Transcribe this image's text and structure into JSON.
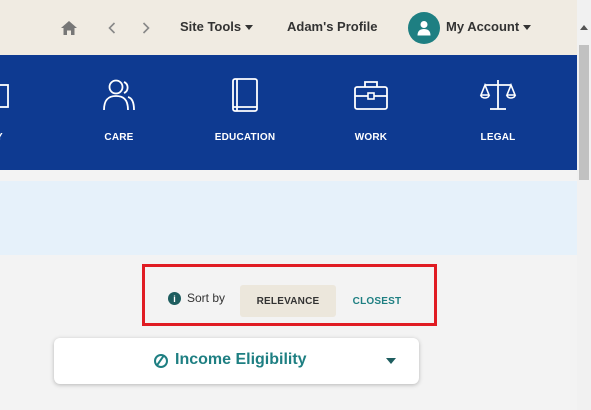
{
  "topbar": {
    "icons": {
      "home": "home-icon",
      "back": "chevron-left-icon",
      "forward": "chevron-right-icon"
    },
    "site_tools_label": "Site Tools",
    "profile_link_label": "Adam's Profile",
    "my_account_label": "My Account"
  },
  "categories": [
    {
      "label": "Y",
      "icon": "partial-icon"
    },
    {
      "label": "CARE",
      "icon": "people-icon"
    },
    {
      "label": "EDUCATION",
      "icon": "book-icon"
    },
    {
      "label": "WORK",
      "icon": "briefcase-icon"
    },
    {
      "label": "LEGAL",
      "icon": "scales-icon"
    }
  ],
  "sort": {
    "label": "Sort by",
    "options": [
      "RELEVANCE",
      "CLOSEST"
    ],
    "selected": "RELEVANCE"
  },
  "filter": {
    "label": "Income Eligibility"
  },
  "colors": {
    "nav_blue": "#0e3a91",
    "teal": "#1e7f82",
    "highlight_red": "#e01b22",
    "topbar_bg": "#f0ebe2",
    "banner_bg": "#e6f1fa"
  }
}
